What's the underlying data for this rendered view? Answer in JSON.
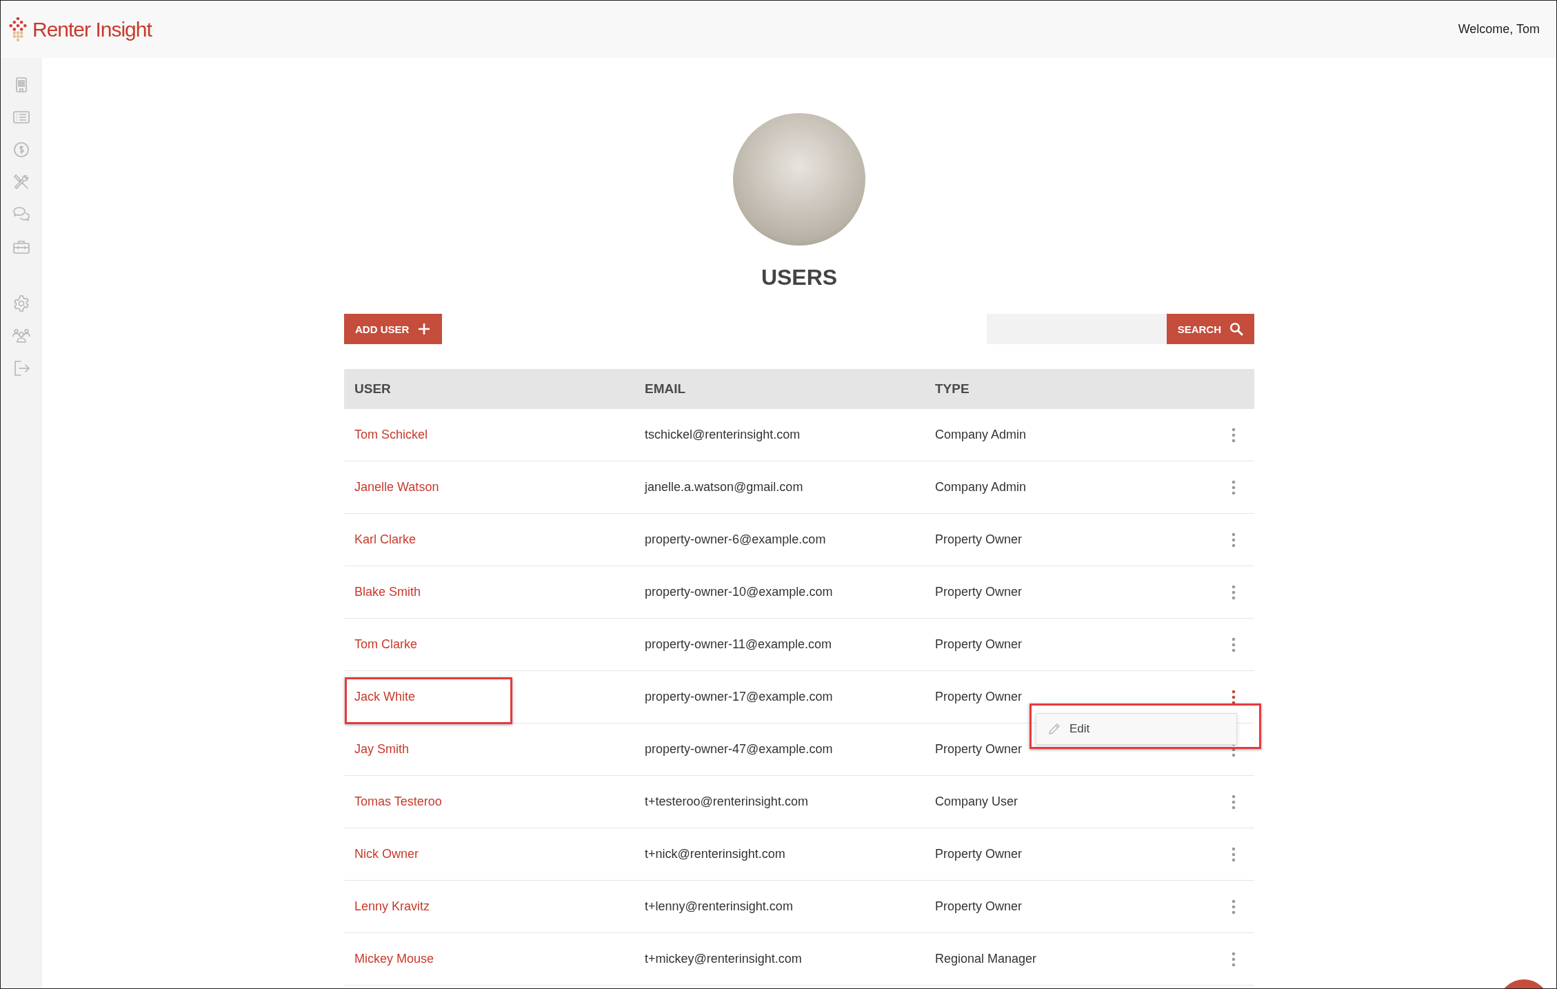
{
  "header": {
    "logo": "Renter Insight",
    "welcome": "Welcome, Tom"
  },
  "page": {
    "title": "USERS",
    "add_button": "ADD USER",
    "search_button": "SEARCH"
  },
  "table": {
    "columns": [
      "USER",
      "EMAIL",
      "TYPE"
    ],
    "rows": [
      {
        "user": "Tom Schickel",
        "email": "tschickel@renterinsight.com",
        "type": "Company Admin",
        "highlighted": false,
        "menu_open": false
      },
      {
        "user": "Janelle Watson",
        "email": "janelle.a.watson@gmail.com",
        "type": "Company Admin",
        "highlighted": false,
        "menu_open": false
      },
      {
        "user": "Karl Clarke",
        "email": "property-owner-6@example.com",
        "type": "Property Owner",
        "highlighted": false,
        "menu_open": false
      },
      {
        "user": "Blake Smith",
        "email": "property-owner-10@example.com",
        "type": "Property Owner",
        "highlighted": false,
        "menu_open": false
      },
      {
        "user": "Tom Clarke",
        "email": "property-owner-11@example.com",
        "type": "Property Owner",
        "highlighted": false,
        "menu_open": false
      },
      {
        "user": "Jack White",
        "email": "property-owner-17@example.com",
        "type": "Property Owner",
        "highlighted": true,
        "menu_open": true
      },
      {
        "user": "Jay Smith",
        "email": "property-owner-47@example.com",
        "type": "Property Owner",
        "highlighted": false,
        "menu_open": false
      },
      {
        "user": "Tomas Testeroo",
        "email": "t+testeroo@renterinsight.com",
        "type": "Company User",
        "highlighted": false,
        "menu_open": false
      },
      {
        "user": "Nick Owner",
        "email": "t+nick@renterinsight.com",
        "type": "Property Owner",
        "highlighted": false,
        "menu_open": false
      },
      {
        "user": "Lenny Kravitz",
        "email": "t+lenny@renterinsight.com",
        "type": "Property Owner",
        "highlighted": false,
        "menu_open": false
      },
      {
        "user": "Mickey Mouse",
        "email": "t+mickey@renterinsight.com",
        "type": "Regional Manager",
        "highlighted": false,
        "menu_open": false
      }
    ]
  },
  "row_menu": {
    "items": [
      "Edit"
    ],
    "highlighted": true
  }
}
